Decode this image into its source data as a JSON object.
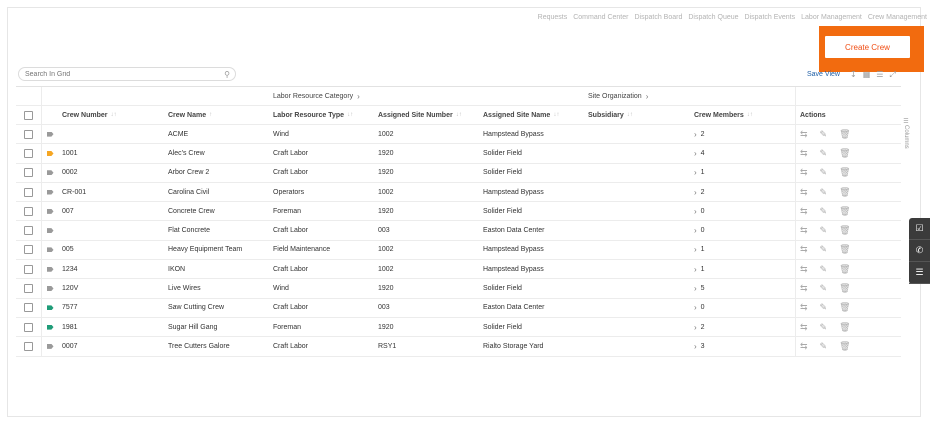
{
  "topnav": [
    "Requests",
    "Command Center",
    "Dispatch Board",
    "Dispatch Queue",
    "Dispatch Events",
    "Labor Management",
    "Crew Management"
  ],
  "create_button": "Create Crew",
  "search_placeholder": "Search In Grid",
  "save_view": "Save View",
  "groups": {
    "labor": "Labor Resource Category",
    "site": "Site Organization"
  },
  "columns": [
    "Crew Number",
    "Crew Name",
    "Labor Resource Type",
    "Assigned Site Number",
    "Assigned Site Name",
    "Subsidiary",
    "Crew Members",
    "Actions"
  ],
  "columns_tab": "Columns",
  "rows": [
    {
      "tag": "gray",
      "num": "",
      "name": "ACME",
      "type": "Wind",
      "snum": "1002",
      "sname": "Hampstead Bypass",
      "sub": "",
      "mem": "2"
    },
    {
      "tag": "yellow",
      "num": "1001",
      "name": "Alec's Crew",
      "type": "Craft Labor",
      "snum": "1920",
      "sname": "Solider Field",
      "sub": "",
      "mem": "4"
    },
    {
      "tag": "gray",
      "num": "0002",
      "name": "Arbor Crew 2",
      "type": "Craft Labor",
      "snum": "1920",
      "sname": "Solider Field",
      "sub": "",
      "mem": "1"
    },
    {
      "tag": "gray",
      "num": "CR-001",
      "name": "Carolina Civil",
      "type": "Operators",
      "snum": "1002",
      "sname": "Hampstead Bypass",
      "sub": "",
      "mem": "2"
    },
    {
      "tag": "gray",
      "num": "007",
      "name": "Concrete Crew",
      "type": "Foreman",
      "snum": "1920",
      "sname": "Solider Field",
      "sub": "",
      "mem": "0"
    },
    {
      "tag": "gray",
      "num": "",
      "name": "Flat Concrete",
      "type": "Craft Labor",
      "snum": "003",
      "sname": "Easton Data Center",
      "sub": "",
      "mem": "0"
    },
    {
      "tag": "gray",
      "num": "005",
      "name": "Heavy Equipment Team",
      "type": "Field Maintenance",
      "snum": "1002",
      "sname": "Hampstead Bypass",
      "sub": "",
      "mem": "1"
    },
    {
      "tag": "gray",
      "num": "1234",
      "name": "IKON",
      "type": "Craft Labor",
      "snum": "1002",
      "sname": "Hampstead Bypass",
      "sub": "",
      "mem": "1"
    },
    {
      "tag": "gray",
      "num": "120V",
      "name": "Live Wires",
      "type": "Wind",
      "snum": "1920",
      "sname": "Solider Field",
      "sub": "",
      "mem": "5"
    },
    {
      "tag": "green",
      "num": "7577",
      "name": "Saw Cutting Crew",
      "type": "Craft Labor",
      "snum": "003",
      "sname": "Easton Data Center",
      "sub": "",
      "mem": "0"
    },
    {
      "tag": "green",
      "num": "1981",
      "name": "Sugar Hill Gang",
      "type": "Foreman",
      "snum": "1920",
      "sname": "Solider Field",
      "sub": "",
      "mem": "2"
    },
    {
      "tag": "gray",
      "num": "0007",
      "name": "Tree Cutters Galore",
      "type": "Craft Labor",
      "snum": "RSY1",
      "sname": "Rialto Storage Yard",
      "sub": "",
      "mem": "3"
    }
  ]
}
